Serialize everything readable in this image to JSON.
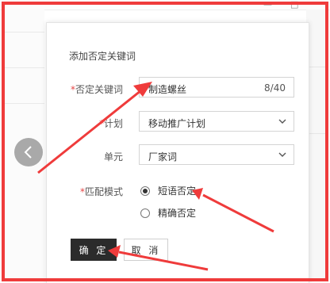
{
  "window": {
    "minimize_glyph": "—",
    "maximize_glyph": "□"
  },
  "nav": {
    "prev_icon": "chevron-left-icon"
  },
  "dialog": {
    "title": "添加否定关键词",
    "keyword": {
      "required_mark": "*",
      "label": "否定关键词",
      "value": "制造螺丝",
      "count": "8/40"
    },
    "plan": {
      "required_mark": "*",
      "label": "计划",
      "value": "移动推广计划",
      "icon": "chevron-down-icon"
    },
    "unit": {
      "label": "单元",
      "value": "厂家词",
      "icon": "chevron-down-icon"
    },
    "match": {
      "required_mark": "*",
      "label": "匹配模式",
      "options": [
        {
          "label": "短语否定",
          "selected": true
        },
        {
          "label": "精确否定",
          "selected": false
        }
      ]
    },
    "confirm_label": "确 定",
    "cancel_label": "取 消"
  },
  "annotation": {
    "color": "#ef3b3b"
  },
  "colors": {
    "primary_button": "#2b2b2b",
    "required": "#e64545"
  }
}
